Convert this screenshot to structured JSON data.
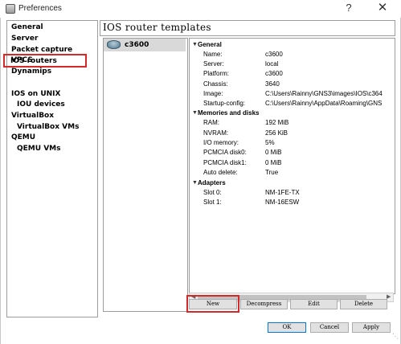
{
  "window": {
    "title": "Preferences",
    "help": "?",
    "close": "✕"
  },
  "sidebar": {
    "items": [
      {
        "label": "General",
        "level": 0
      },
      {
        "label": "Server",
        "level": 0
      },
      {
        "label": "Packet capture",
        "level": 0
      },
      {
        "label": "VPCS",
        "level": 0
      },
      {
        "label": "Dynamips",
        "level": 0
      },
      {
        "label": "IOS routers",
        "level": 1,
        "selected": true
      },
      {
        "label": "IOS on UNIX",
        "level": 0
      },
      {
        "label": "IOU devices",
        "level": 1
      },
      {
        "label": "VirtualBox",
        "level": 0
      },
      {
        "label": "VirtualBox VMs",
        "level": 1
      },
      {
        "label": "QEMU",
        "level": 0
      },
      {
        "label": "QEMU VMs",
        "level": 1
      }
    ]
  },
  "main": {
    "title": "IOS router templates",
    "templates": [
      {
        "name": "c3600",
        "icon": "router-icon"
      }
    ],
    "details": {
      "sections": [
        {
          "name": "General",
          "rows": [
            {
              "key": "Name:",
              "value": "c3600"
            },
            {
              "key": "Server:",
              "value": "local"
            },
            {
              "key": "Platform:",
              "value": "c3600"
            },
            {
              "key": "Chassis:",
              "value": "3640"
            },
            {
              "key": "Image:",
              "value": "C:\\Users\\Rainny\\GNS3\\images\\IOS\\c364"
            },
            {
              "key": "Startup-config:",
              "value": "C:\\Users\\Rainny\\AppData\\Roaming\\GNS"
            }
          ]
        },
        {
          "name": "Memories and disks",
          "rows": [
            {
              "key": "RAM:",
              "value": "192 MiB"
            },
            {
              "key": "NVRAM:",
              "value": "256 KiB"
            },
            {
              "key": "I/O memory:",
              "value": "5%"
            },
            {
              "key": "PCMCIA disk0:",
              "value": "0 MiB"
            },
            {
              "key": "PCMCIA disk1:",
              "value": "0 MiB"
            },
            {
              "key": "Auto delete:",
              "value": "True"
            }
          ]
        },
        {
          "name": "Adapters",
          "rows": [
            {
              "key": "Slot 0:",
              "value": "NM-1FE-TX"
            },
            {
              "key": "Slot 1:",
              "value": "NM-16ESW"
            }
          ]
        }
      ]
    },
    "buttons": {
      "new": "New",
      "decompress": "Decompress",
      "edit": "Edit",
      "delete": "Delete"
    }
  },
  "footer": {
    "ok": "OK",
    "cancel": "Cancel",
    "apply": "Apply"
  },
  "colors": {
    "highlight": "#d22a2a",
    "selection_bg": "#d9d9d9"
  }
}
